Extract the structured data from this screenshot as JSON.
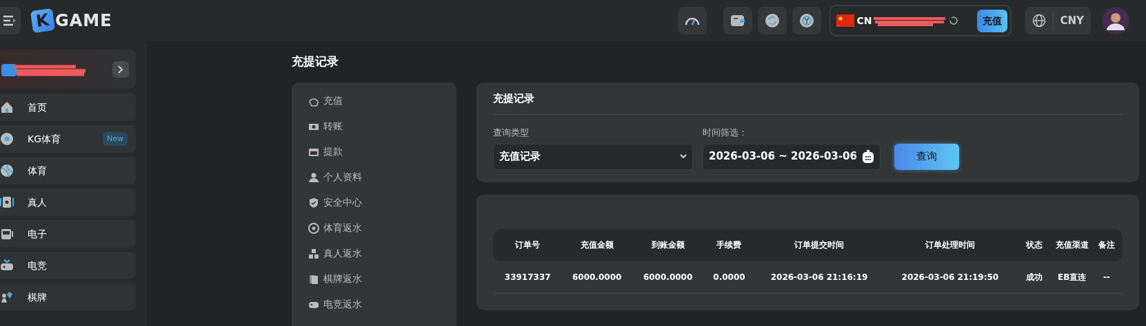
{
  "header": {
    "logo": "KGAME",
    "balance_prefix": "CN",
    "deposit_button": "充值",
    "currency": "CNY"
  },
  "sidebar": {
    "items": [
      {
        "label": "首页"
      },
      {
        "label": "KG体育",
        "badge": "New"
      },
      {
        "label": "体育"
      },
      {
        "label": "真人"
      },
      {
        "label": "电子"
      },
      {
        "label": "电竞"
      },
      {
        "label": "棋牌"
      }
    ]
  },
  "page_title": "充提记录",
  "submenu": {
    "items": [
      {
        "label": "充值"
      },
      {
        "label": "转账"
      },
      {
        "label": "提款"
      },
      {
        "label": "个人资料"
      },
      {
        "label": "安全中心"
      },
      {
        "label": "体育返水"
      },
      {
        "label": "真人返水"
      },
      {
        "label": "棋牌返水"
      },
      {
        "label": "电竞返水"
      }
    ]
  },
  "filter": {
    "title": "充提记录",
    "type_label": "查询类型",
    "type_value": "充值记录",
    "time_label": "时间筛选：",
    "time_value": "2026-03-06 ~ 2026-03-06",
    "query_button": "查询"
  },
  "table": {
    "columns": [
      "订单号",
      "充值金额",
      "到账金额",
      "手续费",
      "订单提交时间",
      "订单处理时间",
      "状态",
      "充值渠道",
      "备注"
    ],
    "rows": [
      [
        "33917337",
        "6000.0000",
        "6000.0000",
        "0.0000",
        "2026-03-06 21:16:19",
        "2026-03-06 21:19:50",
        "成功",
        "EB直连",
        "--"
      ]
    ]
  }
}
